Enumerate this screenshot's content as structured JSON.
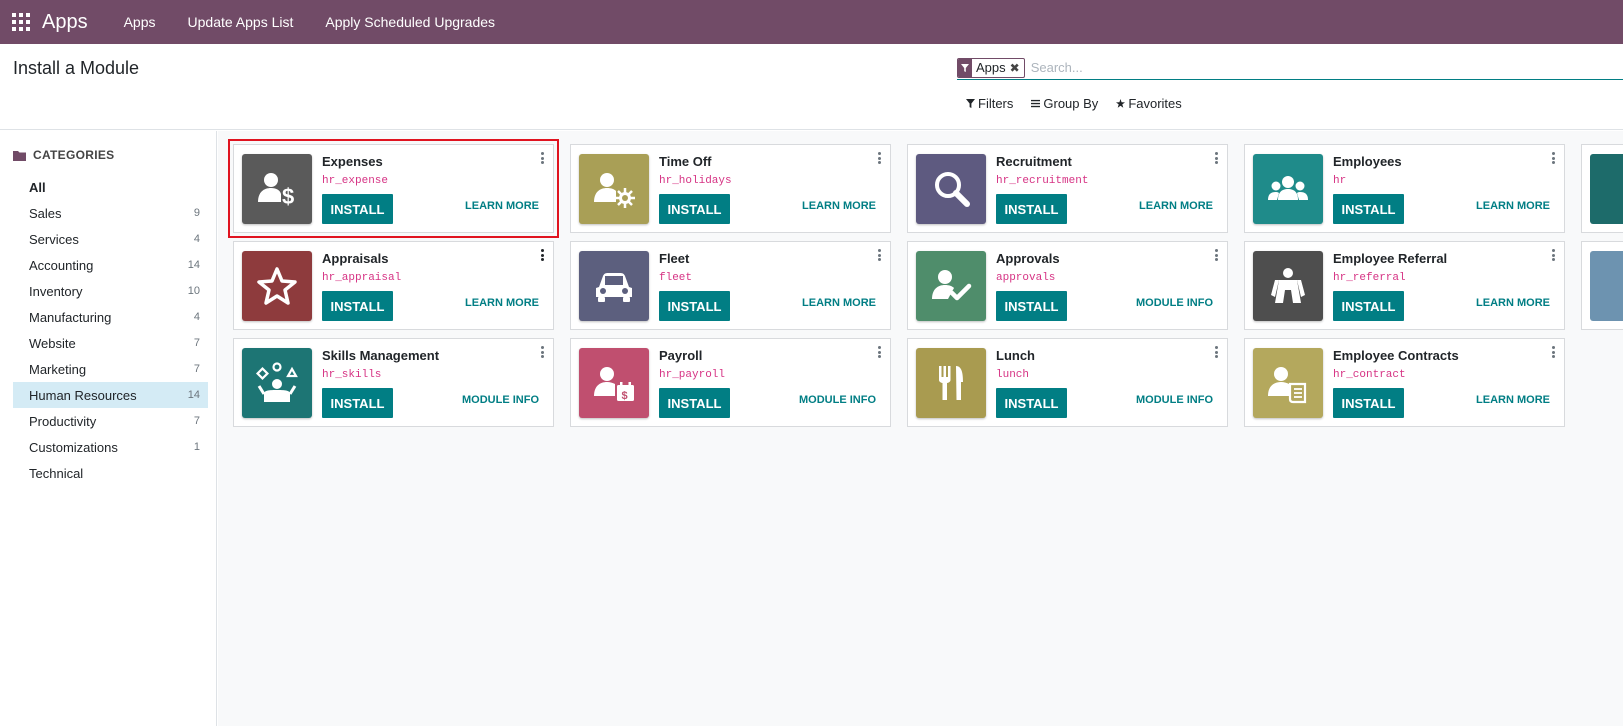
{
  "navbar": {
    "brand": "Apps",
    "menu": [
      "Apps",
      "Update Apps List",
      "Apply Scheduled Upgrades"
    ]
  },
  "control_panel": {
    "title": "Install a Module",
    "search": {
      "facet": "Apps",
      "placeholder": "Search..."
    },
    "filters_label": "Filters",
    "group_by_label": "Group By",
    "favorites_label": "Favorites"
  },
  "sidebar": {
    "header": "CATEGORIES",
    "items": [
      {
        "label": "All",
        "count": ""
      },
      {
        "label": "Sales",
        "count": "9"
      },
      {
        "label": "Services",
        "count": "4"
      },
      {
        "label": "Accounting",
        "count": "14"
      },
      {
        "label": "Inventory",
        "count": "10"
      },
      {
        "label": "Manufacturing",
        "count": "4"
      },
      {
        "label": "Website",
        "count": "7"
      },
      {
        "label": "Marketing",
        "count": "7"
      },
      {
        "label": "Human Resources",
        "count": "14"
      },
      {
        "label": "Productivity",
        "count": "7"
      },
      {
        "label": "Customizations",
        "count": "1"
      },
      {
        "label": "Technical",
        "count": ""
      }
    ],
    "active_index": 8
  },
  "apps": [
    {
      "name": "Expenses",
      "technical": "hr_expense",
      "install": "INSTALL",
      "link": "LEARN MORE",
      "icon": "expenses-icon",
      "color": "#5a5a5a"
    },
    {
      "name": "Time Off",
      "technical": "hr_holidays",
      "install": "INSTALL",
      "link": "LEARN MORE",
      "icon": "time-off-icon",
      "color": "#a99f56"
    },
    {
      "name": "Recruitment",
      "technical": "hr_recruitment",
      "install": "INSTALL",
      "link": "LEARN MORE",
      "icon": "recruitment-icon",
      "color": "#5e5a80"
    },
    {
      "name": "Employees",
      "technical": "hr",
      "install": "INSTALL",
      "link": "LEARN MORE",
      "icon": "employees-icon",
      "color": "#1f8b8a"
    },
    {
      "name": "Appraisals",
      "technical": "hr_appraisal",
      "install": "INSTALL",
      "link": "LEARN MORE",
      "icon": "appraisals-icon",
      "color": "#8e3b3d"
    },
    {
      "name": "Fleet",
      "technical": "fleet",
      "install": "INSTALL",
      "link": "LEARN MORE",
      "icon": "fleet-icon",
      "color": "#5c5f7e"
    },
    {
      "name": "Approvals",
      "technical": "approvals",
      "install": "INSTALL",
      "link": "MODULE INFO",
      "icon": "approvals-icon",
      "color": "#4f8d6b"
    },
    {
      "name": "Employee Referral",
      "technical": "hr_referral",
      "install": "INSTALL",
      "link": "LEARN MORE",
      "icon": "referral-icon",
      "color": "#4e4e4e"
    },
    {
      "name": "Skills Management",
      "technical": "hr_skills",
      "install": "INSTALL",
      "link": "MODULE INFO",
      "icon": "skills-icon",
      "color": "#1d7574"
    },
    {
      "name": "Payroll",
      "technical": "hr_payroll",
      "install": "INSTALL",
      "link": "MODULE INFO",
      "icon": "payroll-icon",
      "color": "#c04f6f"
    },
    {
      "name": "Lunch",
      "technical": "lunch",
      "install": "INSTALL",
      "link": "MODULE INFO",
      "icon": "lunch-icon",
      "color": "#a99b50"
    },
    {
      "name": "Employee Contracts",
      "technical": "hr_contract",
      "install": "INSTALL",
      "link": "LEARN MORE",
      "icon": "contracts-icon",
      "color": "#b4a85d"
    }
  ],
  "colors": {
    "brand": "#714b67",
    "accent": "#017e84",
    "technical_name": "#d63384",
    "highlight": "#e0131f"
  }
}
